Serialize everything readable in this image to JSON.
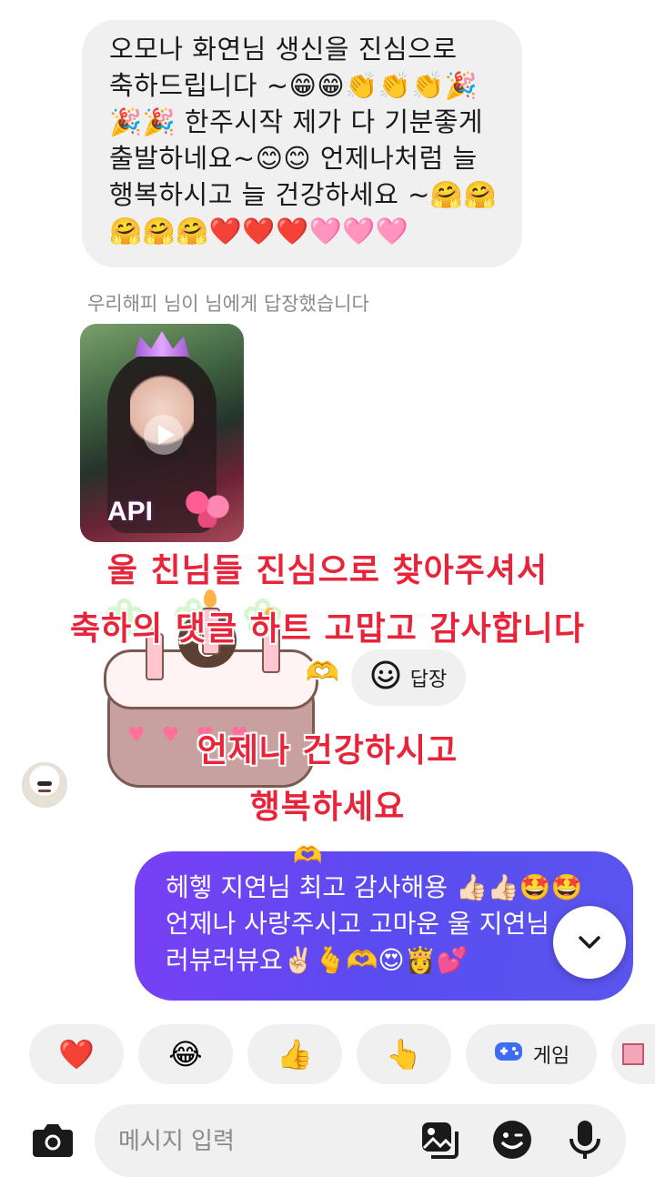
{
  "incoming_message": {
    "lines": [
      "오모나 화연님 생신을 진심으로",
      "축하드립니다 ~😁😁👏👏👏🎉",
      "🎉🎉 한주시작 제가 다 기분좋게",
      "출발하네요~😊😊 언제나처럼 늘",
      "행복하시고 늘 건강하세요 ~🤗🤗",
      "🤗🤗🤗❤️❤️❤️🩷🩷🩷"
    ]
  },
  "reply_note": "우리해피 님이  님에게 답장했습니다",
  "video_thumbnail": {
    "caption": "API"
  },
  "overlay_captions": [
    "울 친님들 진심으로 찾아주셔서",
    "축하의 댓글 하트 고맙고 감사합니다",
    "🫶",
    "언제나 건강하시고",
    "행복하세요"
  ],
  "reply_button": {
    "label": "답장"
  },
  "outgoing_message": {
    "lines": [
      "헤헿 지연님 최고 감사해용 👍🏻👍🏻🤩🤩",
      "언제나 사랑주시고 고마운 울 지연님",
      "러뷰러뷰요✌🏻🫰🫶😍👸💕"
    ]
  },
  "quick_reactions": [
    {
      "emoji": "❤️",
      "label": ""
    },
    {
      "emoji": "😂",
      "label": ""
    },
    {
      "emoji": "👍",
      "label": ""
    },
    {
      "emoji": "👆",
      "label": ""
    },
    {
      "emoji": "🎮",
      "label": "게임"
    }
  ],
  "composer": {
    "placeholder": "메시지 입력"
  },
  "colors": {
    "accent": "#5a4cf0",
    "overlay_text": "#e8243a",
    "bubble_in": "#f0f0f0"
  }
}
